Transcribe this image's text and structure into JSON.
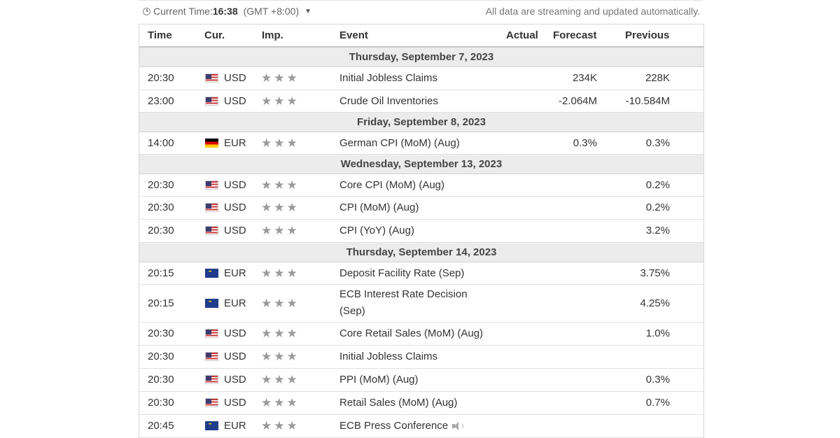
{
  "topbar": {
    "time_label": "Current Time:",
    "time_value": "16:38",
    "timezone": "(GMT +8:00)",
    "status_text": "All data are streaming and updated automatically."
  },
  "columns": {
    "time": "Time",
    "currency": "Cur.",
    "importance": "Imp.",
    "event": "Event",
    "actual": "Actual",
    "forecast": "Forecast",
    "previous": "Previous"
  },
  "groups": [
    {
      "date": "Thursday, September 7, 2023",
      "rows": [
        {
          "time": "20:30",
          "flag": "us",
          "cur": "USD",
          "stars": "★★★",
          "event": "Initial Jobless Claims",
          "actual": "",
          "forecast": "234K",
          "previous": "228K"
        },
        {
          "time": "23:00",
          "flag": "us",
          "cur": "USD",
          "stars": "★★★",
          "event": "Crude Oil Inventories",
          "actual": "",
          "forecast": "-2.064M",
          "previous": "-10.584M"
        }
      ]
    },
    {
      "date": "Friday, September 8, 2023",
      "rows": [
        {
          "time": "14:00",
          "flag": "de",
          "cur": "EUR",
          "stars": "★★★",
          "event": "German CPI (MoM) (Aug)",
          "actual": "",
          "forecast": "0.3%",
          "previous": "0.3%"
        }
      ]
    },
    {
      "date": "Wednesday, September 13, 2023",
      "rows": [
        {
          "time": "20:30",
          "flag": "us",
          "cur": "USD",
          "stars": "★★★",
          "event": "Core CPI (MoM) (Aug)",
          "actual": "",
          "forecast": "",
          "previous": "0.2%"
        },
        {
          "time": "20:30",
          "flag": "us",
          "cur": "USD",
          "stars": "★★★",
          "event": "CPI (MoM) (Aug)",
          "actual": "",
          "forecast": "",
          "previous": "0.2%"
        },
        {
          "time": "20:30",
          "flag": "us",
          "cur": "USD",
          "stars": "★★★",
          "event": "CPI (YoY) (Aug)",
          "actual": "",
          "forecast": "",
          "previous": "3.2%"
        }
      ]
    },
    {
      "date": "Thursday, September 14, 2023",
      "rows": [
        {
          "time": "20:15",
          "flag": "eu",
          "cur": "EUR",
          "stars": "★★★",
          "event": "Deposit Facility Rate (Sep)",
          "actual": "",
          "forecast": "",
          "previous": "3.75%"
        },
        {
          "time": "20:15",
          "flag": "eu",
          "cur": "EUR",
          "stars": "★★★",
          "event": "ECB Interest Rate Decision (Sep)",
          "actual": "",
          "forecast": "",
          "previous": "4.25%"
        },
        {
          "time": "20:30",
          "flag": "us",
          "cur": "USD",
          "stars": "★★★",
          "event": "Core Retail Sales (MoM) (Aug)",
          "actual": "",
          "forecast": "",
          "previous": "1.0%"
        },
        {
          "time": "20:30",
          "flag": "us",
          "cur": "USD",
          "stars": "★★★",
          "event": "Initial Jobless Claims",
          "actual": "",
          "forecast": "",
          "previous": ""
        },
        {
          "time": "20:30",
          "flag": "us",
          "cur": "USD",
          "stars": "★★★",
          "event": "PPI (MoM) (Aug)",
          "actual": "",
          "forecast": "",
          "previous": "0.3%"
        },
        {
          "time": "20:30",
          "flag": "us",
          "cur": "USD",
          "stars": "★★★",
          "event": "Retail Sales (MoM) (Aug)",
          "actual": "",
          "forecast": "",
          "previous": "0.7%"
        },
        {
          "time": "20:45",
          "flag": "eu",
          "cur": "EUR",
          "stars": "★★★",
          "event": "ECB Press Conference",
          "actual": "",
          "forecast": "",
          "previous": "",
          "speaker": true
        }
      ]
    }
  ]
}
